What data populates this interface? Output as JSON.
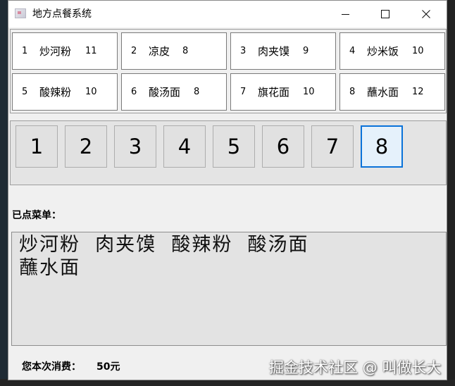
{
  "window": {
    "title": "地方点餐系统"
  },
  "dishes": [
    {
      "num": "1",
      "name": "炒河粉",
      "price": "11"
    },
    {
      "num": "2",
      "name": "凉皮",
      "price": "8"
    },
    {
      "num": "3",
      "name": "肉夹馍",
      "price": "9"
    },
    {
      "num": "4",
      "name": "炒米饭",
      "price": "10"
    },
    {
      "num": "5",
      "name": "酸辣粉",
      "price": "10"
    },
    {
      "num": "6",
      "name": "酸汤面",
      "price": "8"
    },
    {
      "num": "7",
      "name": "旗花面",
      "price": "10"
    },
    {
      "num": "8",
      "name": "蘸水面",
      "price": "12"
    }
  ],
  "keypad": {
    "buttons": [
      "1",
      "2",
      "3",
      "4",
      "5",
      "6",
      "7",
      "8"
    ],
    "active": "8"
  },
  "order": {
    "label": "已点菜单：",
    "text": "炒河粉  肉夹馍  酸辣粉  酸汤面\n蘸水面"
  },
  "total": {
    "label": "您本次消费：",
    "value": "50元"
  },
  "watermark": "掘金技术社区 @ 叫做长大",
  "colors": {
    "accent": "#0a72d9",
    "window_bg": "#f0f0f0",
    "text_box_bg": "#e3e3e3"
  },
  "icons": {
    "app": "app-icon",
    "minimize": "minimize-icon",
    "maximize": "maximize-icon",
    "close": "close-icon"
  }
}
